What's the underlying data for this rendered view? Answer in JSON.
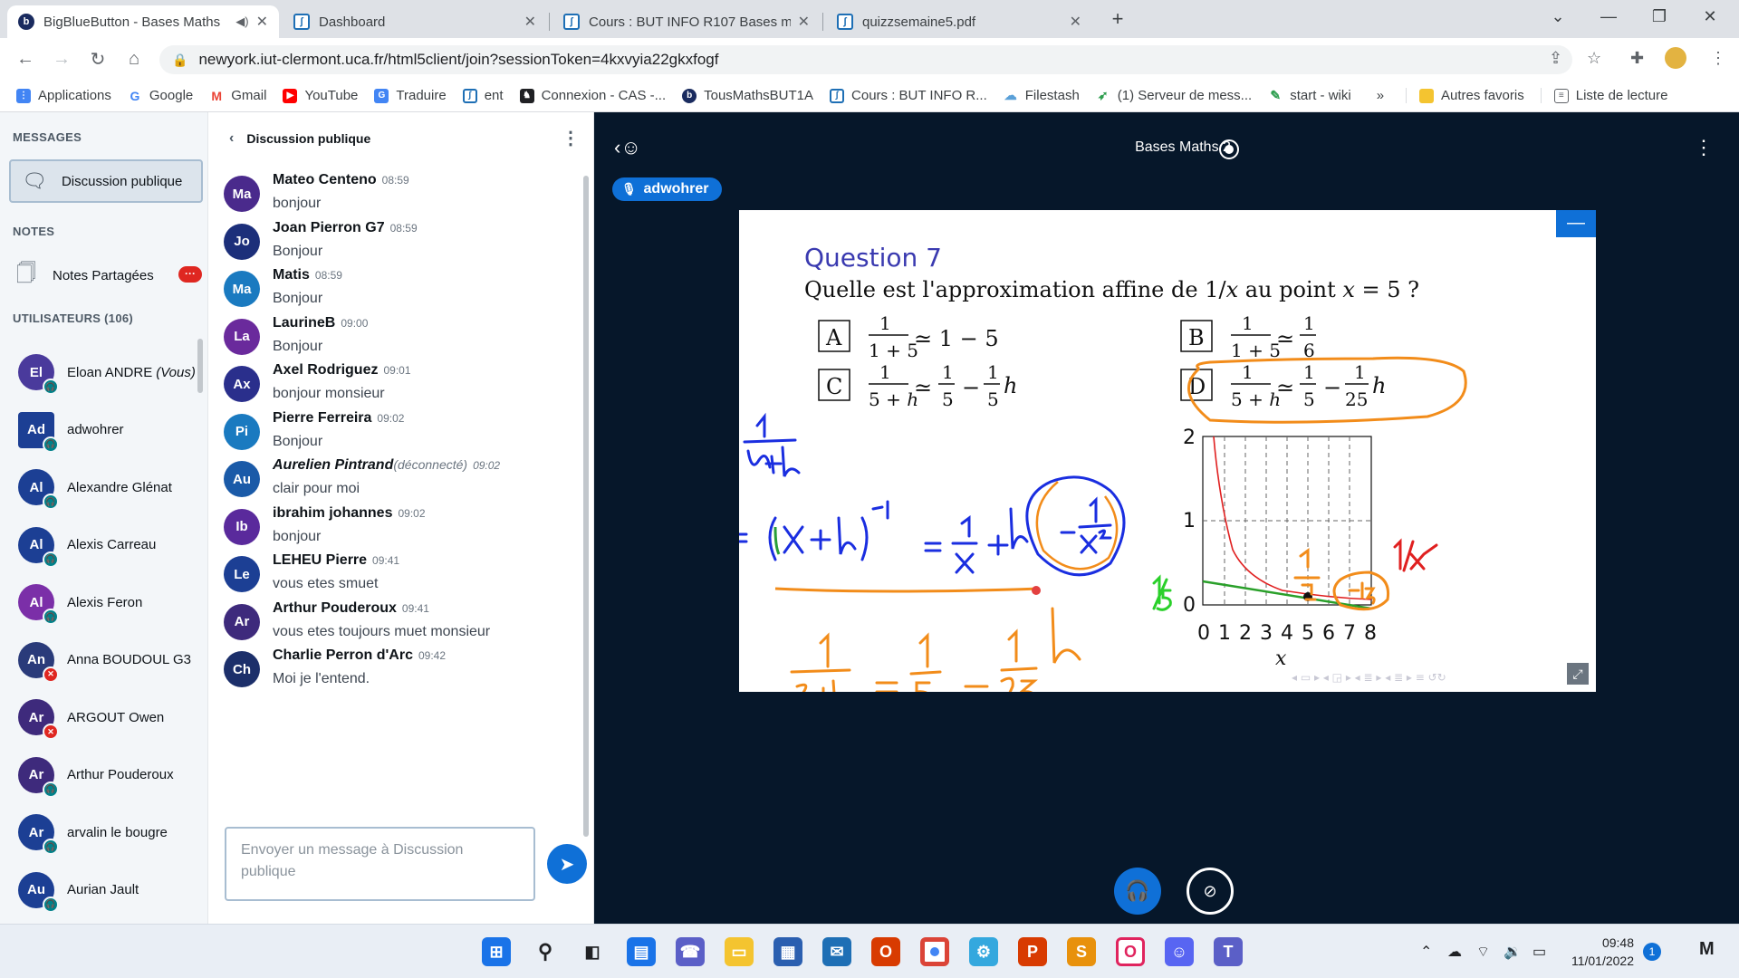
{
  "browser": {
    "tabs": [
      {
        "title": "BigBlueButton - Bases Maths",
        "active": true
      },
      {
        "title": "Dashboard"
      },
      {
        "title": "Cours : BUT INFO R107 Bases ma"
      },
      {
        "title": "quizzsemaine5.pdf"
      }
    ],
    "url": "newyork.iut-clermont.uca.fr/html5client/join?sessionToken=4kxvyia22gkxfogf",
    "bookmarks": [
      "Applications",
      "Google",
      "Gmail",
      "YouTube",
      "Traduire",
      "ent",
      "Connexion - CAS -...",
      "TousMathsBUT1A",
      "Cours : BUT INFO R...",
      "Filestash",
      "(1) Serveur de mess...",
      "start - wiki"
    ],
    "other_bookmarks": "Autres favoris",
    "reading_list": "Liste de lecture",
    "more": "»"
  },
  "sidebar": {
    "messages_title": "MESSAGES",
    "public_chat": "Discussion publique",
    "notes_title": "NOTES",
    "shared_notes": "Notes Partagées",
    "notes_badge": "···",
    "users_title": "UTILISATEURS (106)",
    "users": [
      {
        "initials": "El",
        "name": "Eloan ANDRE",
        "suffix": "(Vous)",
        "color": "#4a3a9c",
        "mic": "on"
      },
      {
        "initials": "Ad",
        "name": "adwohrer",
        "color": "#1c3f94",
        "mic": "on",
        "presenter": true
      },
      {
        "initials": "Al",
        "name": "Alexandre Glénat",
        "color": "#1c3f94",
        "mic": "on"
      },
      {
        "initials": "Al",
        "name": "Alexis Carreau",
        "color": "#1c3f94",
        "mic": "on"
      },
      {
        "initials": "Al",
        "name": "Alexis Feron",
        "color": "#7b2fa8",
        "mic": "on"
      },
      {
        "initials": "An",
        "name": "Anna BOUDOUL G3",
        "color": "#2a3b7a",
        "mic": "muted"
      },
      {
        "initials": "Ar",
        "name": "ARGOUT Owen",
        "color": "#3e2a7c",
        "mic": "muted"
      },
      {
        "initials": "Ar",
        "name": "Arthur Pouderoux",
        "color": "#3e2a7c",
        "mic": "on"
      },
      {
        "initials": "Ar",
        "name": "arvalin le bougre",
        "color": "#1c3f94",
        "mic": "on"
      },
      {
        "initials": "Au",
        "name": "Aurian Jault",
        "color": "#1c3f94",
        "mic": "on"
      }
    ]
  },
  "chat": {
    "title": "Discussion publique",
    "messages": [
      {
        "initials": "Ma",
        "color": "#4a2a8c",
        "name": "Mateo Centeno",
        "time": "08:59",
        "text": "bonjour"
      },
      {
        "initials": "Jo",
        "color": "#1c2f7a",
        "name": "Joan Pierron G7",
        "time": "08:59",
        "text": "Bonjour"
      },
      {
        "initials": "Ma",
        "color": "#1a7ac0",
        "name": "Matis",
        "time": "08:59",
        "text": "Bonjour"
      },
      {
        "initials": "La",
        "color": "#6a2a9c",
        "name": "LaurineB",
        "time": "09:00",
        "text": "Bonjour"
      },
      {
        "initials": "Ax",
        "color": "#2a2f8c",
        "name": "Axel Rodriguez",
        "time": "09:01",
        "text": "bonjour monsieur"
      },
      {
        "initials": "Pi",
        "color": "#1a7ac0",
        "name": "Pierre Ferreira",
        "time": "09:02",
        "text": "Bonjour"
      },
      {
        "initials": "Au",
        "color": "#1a5aa8",
        "name": "Aurelien Pintrand",
        "disconnected": "(déconnecté)",
        "time": "09:02",
        "text": "clair pour moi"
      },
      {
        "initials": "Ib",
        "color": "#5a2a9c",
        "name": "ibrahim johannes",
        "time": "09:02",
        "text": "bonjour"
      },
      {
        "initials": "Le",
        "color": "#1c3f94",
        "name": "LEHEU Pierre",
        "time": "09:41",
        "text": "vous etes smuet"
      },
      {
        "initials": "Ar",
        "color": "#3e2a7c",
        "name": "Arthur Pouderoux",
        "time": "09:41",
        "text": "vous etes toujours muet monsieur"
      },
      {
        "initials": "Ch",
        "color": "#1c2f6a",
        "name": "Charlie Perron d'Arc",
        "time": "09:42",
        "text": "Moi je l'entend."
      }
    ],
    "input_placeholder": "Envoyer un message à Discussion publique"
  },
  "presentation": {
    "title": "Bases Maths 2",
    "talker": "adwohrer",
    "question_title": "Question 7",
    "question_text_pre": "Quelle est l'approximation affine de 1/",
    "question_text_var1": "x",
    "question_text_mid": " au point ",
    "question_text_var2": "x",
    "question_text_post": " = 5 ?",
    "options": [
      {
        "letter": "A",
        "rhs": "≃ 1 − 5"
      },
      {
        "letter": "B"
      },
      {
        "letter": "C"
      },
      {
        "letter": "D"
      }
    ],
    "graph": {
      "y_ticks": [
        "0",
        "1",
        "2"
      ],
      "x_ticks": [
        "0",
        "1",
        "2",
        "3",
        "4",
        "5",
        "6",
        "7",
        "8"
      ],
      "xlabel": "x"
    }
  },
  "taskbar": {
    "time": "09:48",
    "date": "11/01/2022",
    "notifications": "1"
  }
}
